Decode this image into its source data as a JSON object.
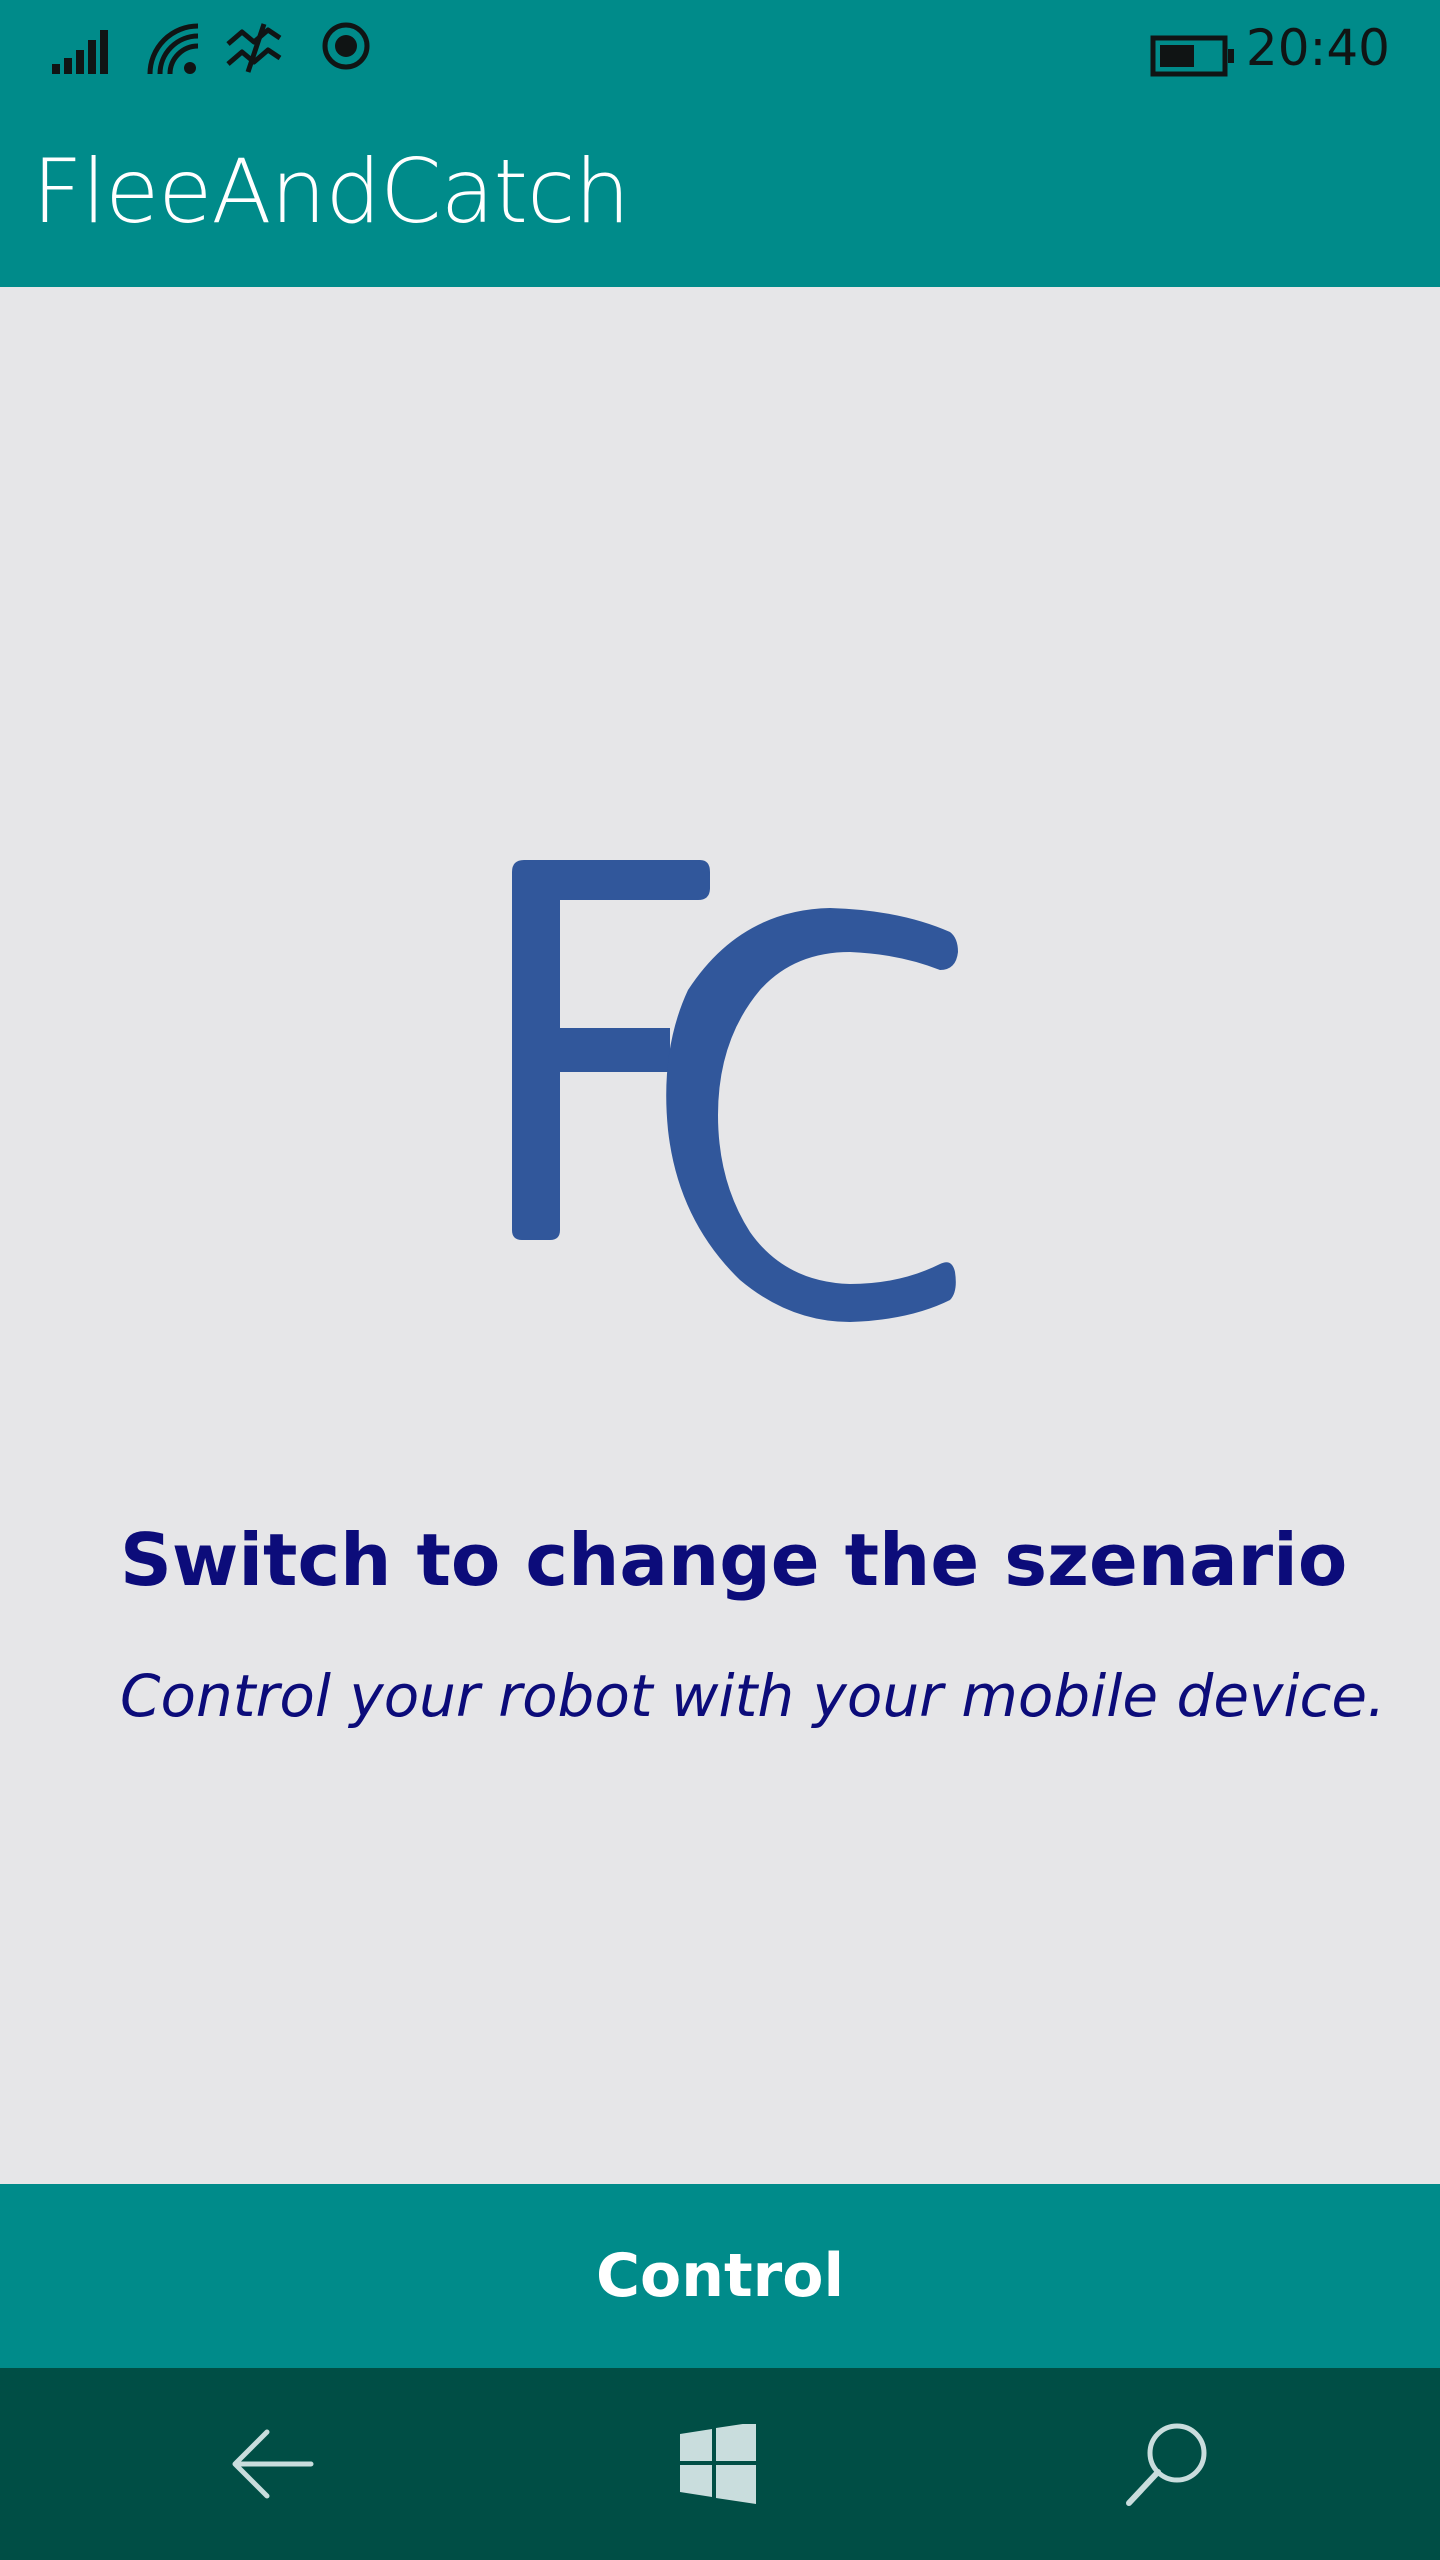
{
  "status_bar": {
    "time": "20:40",
    "icons": [
      "signal-strength-icon",
      "wifi-icon",
      "data-sense-icon",
      "location-icon",
      "battery-icon"
    ]
  },
  "app": {
    "title": "FleeAndCatch"
  },
  "main": {
    "logo_text": "FC",
    "heading": "Switch to change the szenario",
    "subheading": "Control your robot with your mobile device."
  },
  "control": {
    "label": "Control"
  },
  "nav_bar": {
    "icons": [
      "back-arrow-icon",
      "windows-start-icon",
      "search-icon"
    ]
  },
  "colors": {
    "accent": "#008b8a",
    "nav_background": "#004e45",
    "page_background": "#e6e6e8",
    "text_primary": "#0c0c7a",
    "logo": "#31579b"
  }
}
